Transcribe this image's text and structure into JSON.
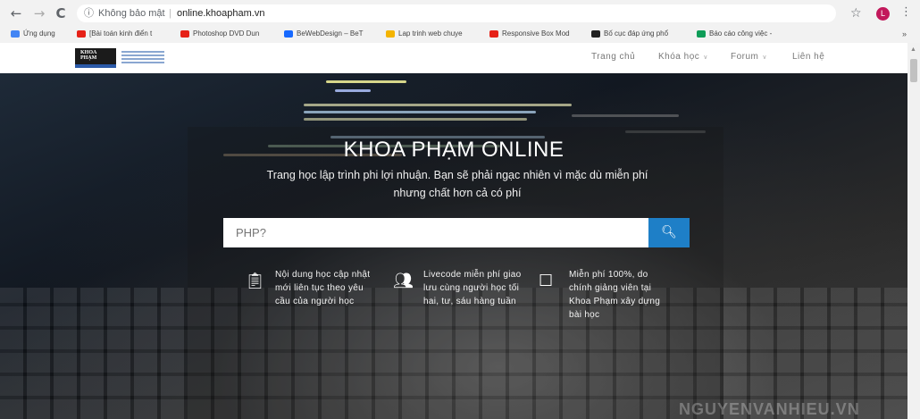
{
  "browser": {
    "nav": {
      "back": "←",
      "forward": "→",
      "reload": "C"
    },
    "security_label": "Không bảo mật",
    "separator": "|",
    "url": "online.khoapham.vn",
    "bookmarks": [
      {
        "label": "Ứng dụng",
        "color": "#4285f4"
      },
      {
        "label": "[Bài toán kinh điển t",
        "color": "#e62117"
      },
      {
        "label": "Photoshop DVD Dun",
        "color": "#e62117"
      },
      {
        "label": "BeWebDesign – BeT",
        "color": "#1769ff"
      },
      {
        "label": "Lap trinh web chuye",
        "color": "#f4b400"
      },
      {
        "label": "Responsive Box Mod",
        "color": "#e62117"
      },
      {
        "label": "Bố cục đáp ứng phổ",
        "color": "#222222"
      },
      {
        "label": "Báo cáo công việc -",
        "color": "#0f9d58"
      }
    ],
    "more_bookmarks": "»",
    "profile_initial": "L",
    "profile_color": "#c2185b"
  },
  "site": {
    "logo_text": [
      "KHOA",
      "PHẠM"
    ],
    "menu": [
      {
        "label": "Trang chủ",
        "has_caret": false
      },
      {
        "label": "Khóa học",
        "has_caret": true
      },
      {
        "label": "Forum",
        "has_caret": true
      },
      {
        "label": "Liên hệ",
        "has_caret": false
      }
    ],
    "hero": {
      "title": "KHOA PHẠM ONLINE",
      "subtitle_line1": "Trang học lập trình phi lợi nhuận. Bạn sẽ phải ngạc nhiên vì mặc dù miễn phí",
      "subtitle_line2": "nhưng chất hơn cả có phí",
      "search_placeholder": "PHP?",
      "search_icon": "search-icon",
      "accent_color": "#1e7fc7"
    },
    "features": [
      {
        "icon": "clipboard-icon",
        "glyph": "📋",
        "text": "Nội dung học cập nhật mới liên tục theo yêu cầu của người học"
      },
      {
        "icon": "users-icon",
        "glyph": "👥",
        "text": "Livecode miễn phí giao lưu cùng người học tối hai, tư, sáu hàng tuần"
      },
      {
        "icon": "square-icon",
        "glyph": "☐",
        "text": "Miễn phí 100%, do chính giảng viên tại Khoa Phạm xây dựng bài học"
      }
    ],
    "watermark": "NGUYENVANHIEU.VN"
  }
}
